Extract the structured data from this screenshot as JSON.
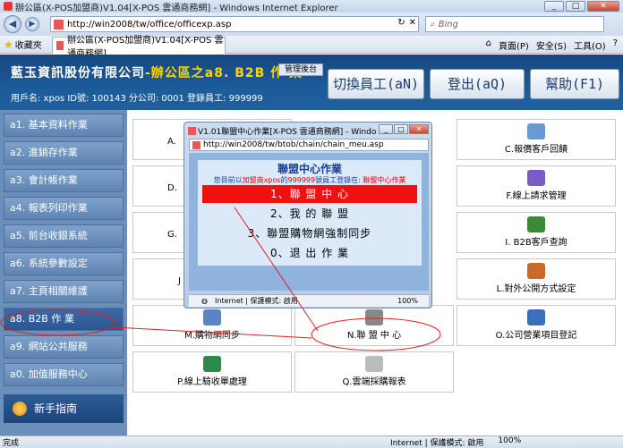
{
  "window_title": "辦公區(X-POS加盟商)V1.04[X-POS 雲通商務網] - Windows Internet Explorer",
  "address": "http://win2008/tw/office/officexp.asp",
  "search_placeholder": "Bing",
  "favorites": "收藏夾",
  "tab_title": "辦公區(X-POS加盟商)V1.04[X-POS 雲通商務網]",
  "cmdbar": {
    "page": "頁面(P)",
    "safety": "安全(S)",
    "tools": "工具(O)"
  },
  "header": {
    "company": "藍玉資訊股份有限公司",
    "sub": "-辦公區之a8. B2B 作 業",
    "mgmt": "管理後台",
    "userinfo": "用戶名: xpos ID號: 100143 分公司: 0001 登錄員工: 999999",
    "switch": "切換員工(aN)",
    "logout": "登出(aQ)",
    "help": "幫助(F1)"
  },
  "sidebar": [
    "a1. 基本資料作業",
    "a2. 進銷存作業",
    "a3. 會計帳作業",
    "a4. 報表列印作業",
    "a5. 前台收銀系統",
    "a6. 系統參數設定",
    "a7. 主頁相關維護",
    "a8. B2B 作 業",
    "a9. 網站公共服務",
    "a0. 加值服務中心"
  ],
  "guide": "新手指南",
  "grid": {
    "A": "A.",
    "C": "C.報價客戶回饋",
    "D": "D.",
    "F": "F.線上請求管理",
    "G": "G.",
    "I": "I. B2B客戶查詢",
    "J": "J",
    "L": "L.對外公開方式設定",
    "M": "M.購物網同步",
    "N": "N.聯 盟 中 心",
    "O": "O.公司營業項目登記",
    "P": "P.線上驗收單處理",
    "Q": "Q.雲端採購報表"
  },
  "popup": {
    "title": "V1.01聯盟中心作業[X-POS 雲通商務網] - Windo...",
    "address": "http://win2008/tw/btob/chain/chain_meu.asp",
    "heading": "聯盟中心作業",
    "info_a": "您目前以",
    "info_b": "加盟商xpos",
    "info_c": "的",
    "info_d": "999999",
    "info_e": "號員工登錄在: ",
    "info_f": "聯盟中心作業",
    "items": [
      "1、聯 盟 中 心",
      "2、我 的 聯 盟",
      "3、聯盟購物網強制同步",
      "0、退 出 作 業"
    ],
    "status": "Internet | 保護模式: 啟用",
    "zoom": "100%"
  },
  "status": {
    "left": "完成",
    "zone": "Internet | 保護模式: 啟用",
    "zoom": "100%"
  }
}
